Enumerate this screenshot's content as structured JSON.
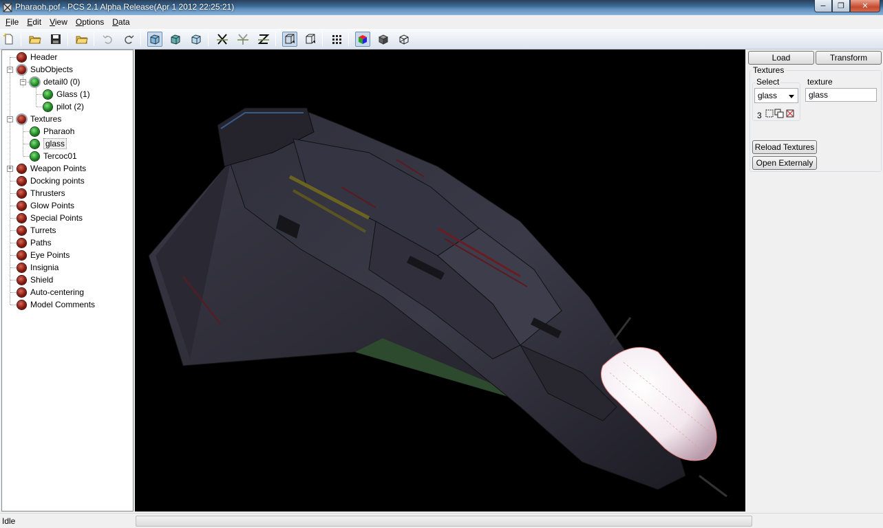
{
  "window": {
    "title": "Pharaoh.pof - PCS 2.1 Alpha Release(Apr  1 2012 22:25:21)",
    "minimize": "−",
    "maximize": "❐",
    "close": "✕"
  },
  "menu": {
    "items": [
      {
        "label": "File",
        "accel": "F",
        "rest": "ile"
      },
      {
        "label": "Edit",
        "accel": "E",
        "rest": "dit"
      },
      {
        "label": "View",
        "accel": "V",
        "rest": "iew"
      },
      {
        "label": "Options",
        "accel": "O",
        "rest": "ptions"
      },
      {
        "label": "Data",
        "accel": "D",
        "rest": "ata"
      }
    ]
  },
  "tree": {
    "items": [
      {
        "label": "Header"
      },
      {
        "label": "SubObjects"
      },
      {
        "label": "detail0 (0)"
      },
      {
        "label": "Glass (1)"
      },
      {
        "label": "pilot (2)"
      },
      {
        "label": "Textures"
      },
      {
        "label": "Pharaoh"
      },
      {
        "label": "glass"
      },
      {
        "label": "Tercoc01"
      },
      {
        "label": "Weapon Points"
      },
      {
        "label": "Docking points"
      },
      {
        "label": "Thrusters"
      },
      {
        "label": "Glow Points"
      },
      {
        "label": "Special Points"
      },
      {
        "label": "Turrets"
      },
      {
        "label": "Paths"
      },
      {
        "label": "Eye Points"
      },
      {
        "label": "Insignia"
      },
      {
        "label": "Shield"
      },
      {
        "label": "Auto-centering"
      },
      {
        "label": "Model Comments"
      }
    ],
    "selected": "glass"
  },
  "panel": {
    "load_label": "Load",
    "transform_label": "Transform",
    "textures_group": "Textures",
    "select_label": "Select",
    "select_value": "glass",
    "texture_label": "texture",
    "texture_value": "glass",
    "texture_count": "3",
    "reload_label": "Reload Textures",
    "open_external_label": "Open Externaly"
  },
  "status": {
    "text": "Idle",
    "progress": 0
  },
  "colors": {
    "viewport_bg": "#000000",
    "accent": "#3a6a96"
  }
}
